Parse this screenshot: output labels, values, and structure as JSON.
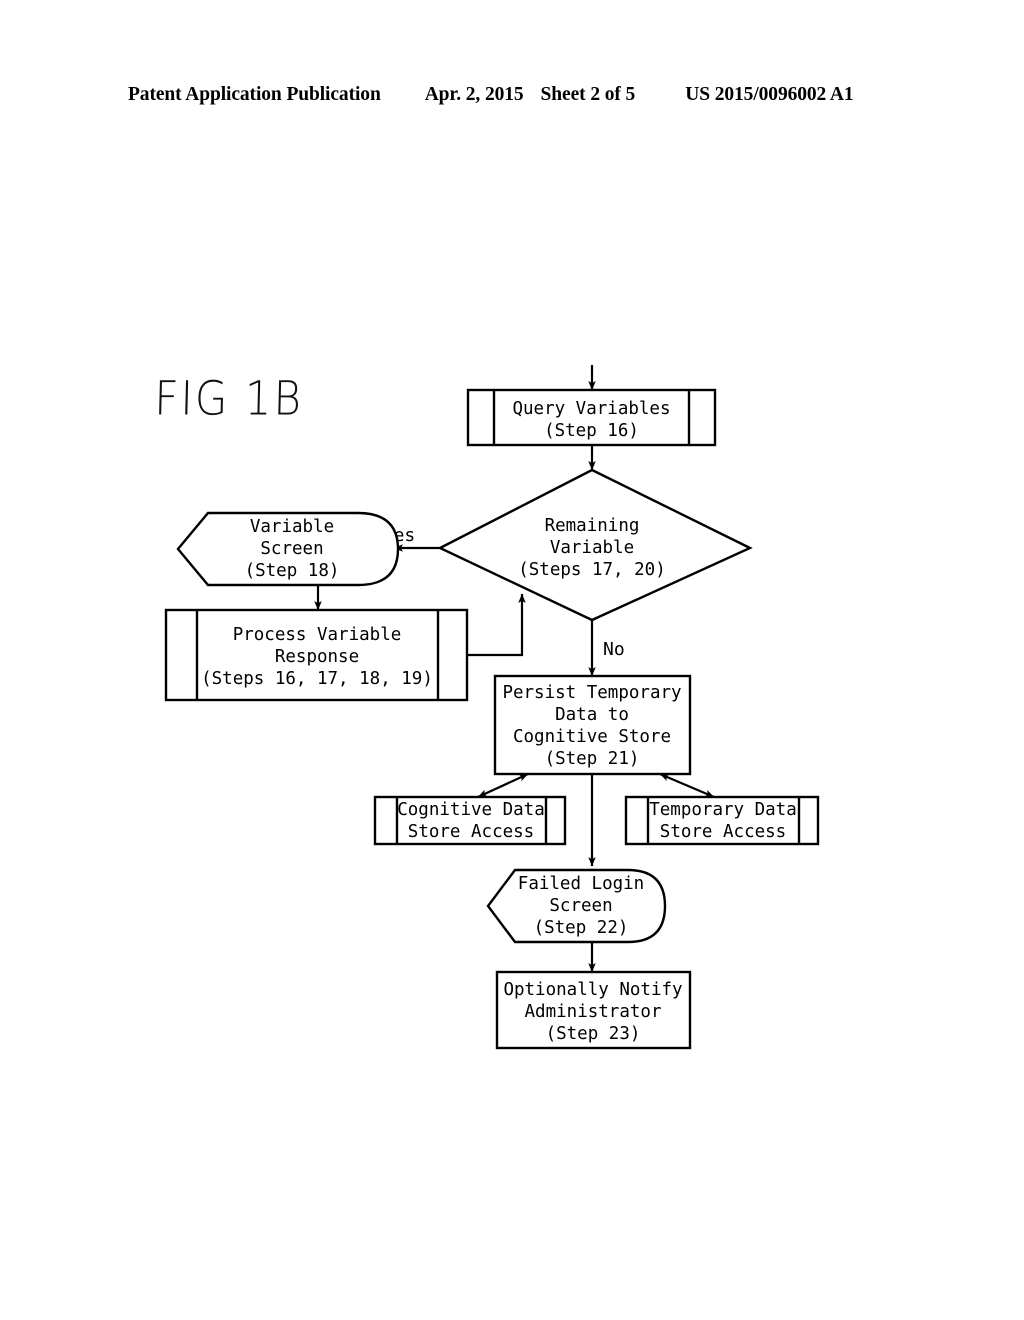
{
  "header": {
    "publication": "Patent Application Publication",
    "date": "Apr. 2, 2015",
    "sheet": "Sheet 2 of 5",
    "number": "US 2015/0096002 A1"
  },
  "figure": {
    "label": "FIG 1B",
    "caption": "FIG 1B"
  },
  "colors": {
    "ink": "#000000",
    "paper": "#ffffff"
  },
  "flowchart": {
    "nodes": [
      {
        "id": "query_variables",
        "shape": "predefined-process",
        "lines": [
          "Query Variables",
          "(Step 16)"
        ],
        "line1": "Query Variables",
        "line2": "(Step 16)",
        "line3": "",
        "line4": ""
      },
      {
        "id": "remaining_variable",
        "shape": "decision",
        "lines": [
          "Remaining",
          "Variable",
          "(Steps 17, 20)"
        ],
        "line1": "Remaining",
        "line2": "Variable",
        "line3": "(Steps 17, 20)",
        "line4": ""
      },
      {
        "id": "variable_screen",
        "shape": "display",
        "lines": [
          "Variable",
          "Screen",
          "(Step 18)"
        ],
        "line1": "Variable",
        "line2": "Screen",
        "line3": "(Step 18)",
        "line4": ""
      },
      {
        "id": "process_variable_response",
        "shape": "predefined-process",
        "lines": [
          "Process Variable",
          "Response",
          "(Steps 16, 17, 18, 19)"
        ],
        "line1": "Process Variable",
        "line2": "Response",
        "line3": "(Steps 16, 17, 18, 19)",
        "line4": ""
      },
      {
        "id": "persist_temporary_data",
        "shape": "process",
        "lines": [
          "Persist Temporary",
          "Data to",
          "Cognitive Store",
          "(Step 21)"
        ],
        "line1": "Persist Temporary",
        "line2": "Data to",
        "line3": "Cognitive Store",
        "line4": "(Step 21)"
      },
      {
        "id": "cognitive_data_store_access",
        "shape": "predefined-process",
        "lines": [
          "Cognitive Data",
          "Store Access"
        ],
        "line1": "Cognitive Data",
        "line2": "Store Access",
        "line3": "",
        "line4": ""
      },
      {
        "id": "temporary_data_store_access",
        "shape": "predefined-process",
        "lines": [
          "Temporary Data",
          "Store Access"
        ],
        "line1": "Temporary Data",
        "line2": "Store Access",
        "line3": "",
        "line4": ""
      },
      {
        "id": "failed_login_screen",
        "shape": "display",
        "lines": [
          "Failed Login",
          "Screen",
          "(Step 22)"
        ],
        "line1": "Failed Login",
        "line2": "Screen",
        "line3": "(Step 22)",
        "line4": ""
      },
      {
        "id": "optionally_notify_administrator",
        "shape": "process",
        "lines": [
          "Optionally Notify",
          "Administrator",
          "(Step 23)"
        ],
        "line1": "Optionally Notify",
        "line2": "Administrator",
        "line3": "(Step 23)",
        "line4": ""
      }
    ],
    "edges": [
      {
        "id": "entry_to_query",
        "from": "",
        "to": "query_variables",
        "label": "",
        "arrow": "single"
      },
      {
        "id": "query_to_decision",
        "from": "query_variables",
        "to": "remaining_variable",
        "label": "",
        "arrow": "single"
      },
      {
        "id": "decision_yes",
        "from": "remaining_variable",
        "to": "variable_screen",
        "label": "Yes",
        "arrow": "single"
      },
      {
        "id": "screen_to_process",
        "from": "variable_screen",
        "to": "process_variable_response",
        "label": "",
        "arrow": "single"
      },
      {
        "id": "process_loopback",
        "from": "process_variable_response",
        "to": "remaining_variable",
        "label": "",
        "arrow": "single"
      },
      {
        "id": "decision_no",
        "from": "remaining_variable",
        "to": "persist_temporary_data",
        "label": "No",
        "arrow": "single"
      },
      {
        "id": "persist_to_cognitive",
        "from": "persist_temporary_data",
        "to": "cognitive_data_store_access",
        "label": "",
        "arrow": "double"
      },
      {
        "id": "persist_to_temporary",
        "from": "persist_temporary_data",
        "to": "temporary_data_store_access",
        "label": "",
        "arrow": "double"
      },
      {
        "id": "persist_to_failed_login",
        "from": "persist_temporary_data",
        "to": "failed_login_screen",
        "label": "",
        "arrow": "single"
      },
      {
        "id": "failed_login_to_notify",
        "from": "failed_login_screen",
        "to": "optionally_notify_administrator",
        "label": "",
        "arrow": "single"
      }
    ],
    "edge_labels": {
      "yes": "Yes",
      "no": "No"
    }
  }
}
